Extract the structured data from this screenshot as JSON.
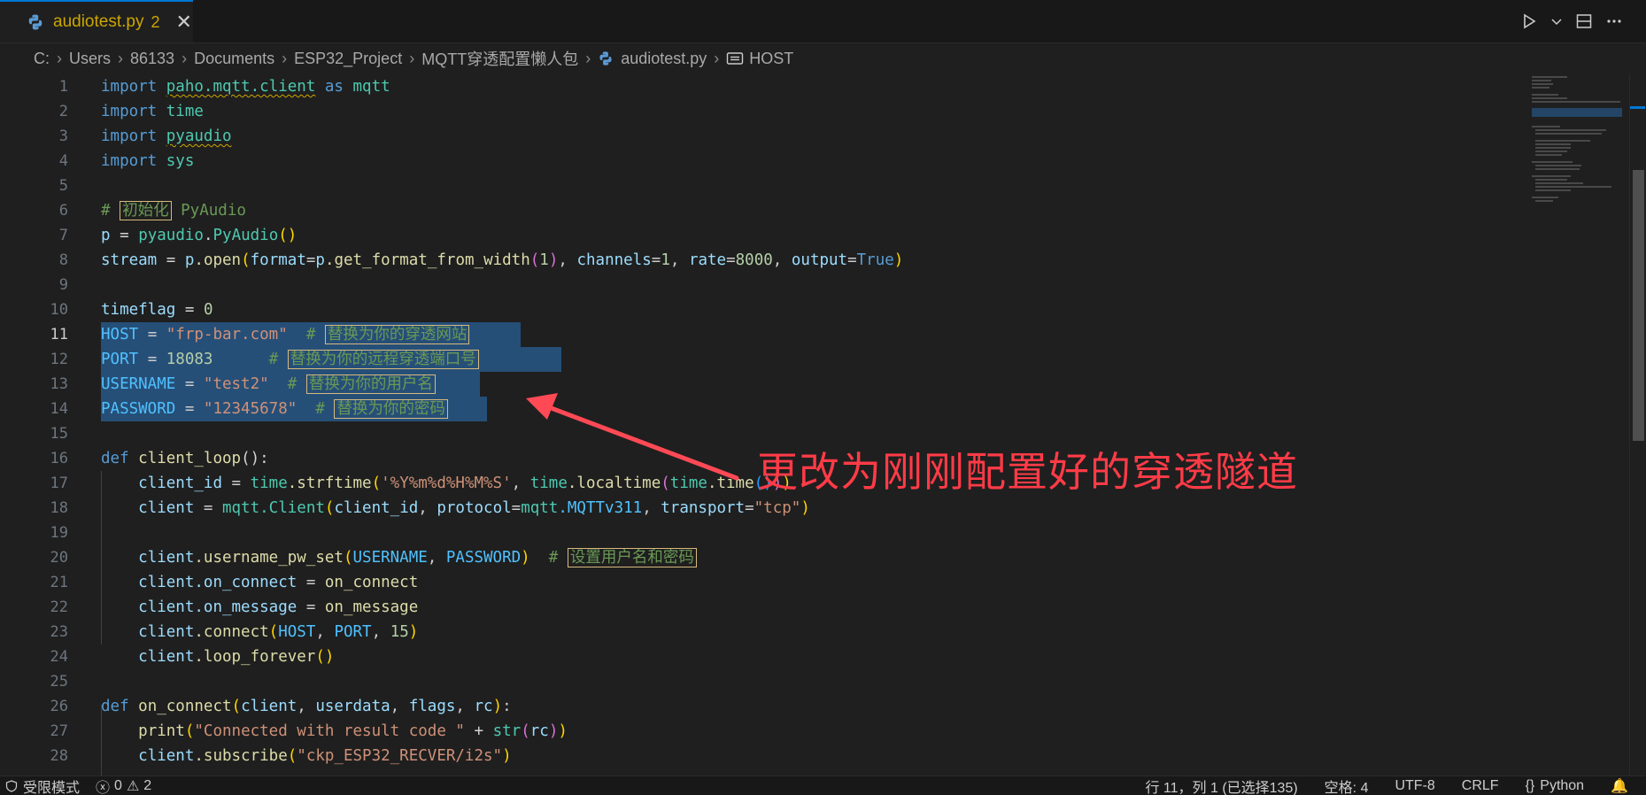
{
  "tab": {
    "filename": "audiotest.py",
    "problems_count": "2",
    "close_glyph": "✕"
  },
  "icons": {
    "file": "python-icon",
    "run": "run-icon",
    "run_menu": "chevron-down-icon",
    "split": "split-editor-icon",
    "more": "more-actions-icon",
    "symbol": "symbol-constant-icon"
  },
  "breadcrumb": {
    "items": [
      "C:",
      "Users",
      "86133",
      "Documents",
      "ESP32_Project",
      "MQTT穿透配置懒人包",
      "audiotest.py",
      "HOST"
    ]
  },
  "annotation": {
    "text": "更改为刚刚配置好的穿透隧道"
  },
  "status": {
    "mode": "受限模式",
    "errors": "0",
    "warnings": "2",
    "position": "行 11，列 1 (已选择135)",
    "indent": "空格: 4",
    "encoding": "UTF-8",
    "eol": "CRLF",
    "language": "Python"
  },
  "line_numbers": [
    "1",
    "2",
    "3",
    "4",
    "5",
    "6",
    "7",
    "8",
    "9",
    "10",
    "11",
    "12",
    "13",
    "14",
    "15",
    "16",
    "17",
    "18",
    "19",
    "20",
    "21",
    "22",
    "23",
    "24",
    "25",
    "26",
    "27",
    "28"
  ],
  "code": {
    "l1": {
      "kw": "import",
      "mod": "paho.mqtt.client",
      "as": "as",
      "alias": "mqtt"
    },
    "l2": {
      "kw": "import",
      "mod": "time"
    },
    "l3": {
      "kw": "import",
      "mod": "pyaudio"
    },
    "l4": {
      "kw": "import",
      "mod": "sys"
    },
    "l6": {
      "hash": "#",
      "zh": "初始化",
      "rest": "PyAudio"
    },
    "l7": {
      "a": "p",
      "eq": "=",
      "b": "pyaudio",
      "dot": ".",
      "c": "PyAudio",
      "par": "()"
    },
    "l8": {
      "a": "stream",
      "eq": "=",
      "b": "p",
      "c": ".open",
      "p1": "(",
      "k1": "format",
      "v1": "p",
      "f1": ".get_format_from_width",
      "p2": "(",
      "n1": "1",
      "p3": ")",
      "k2": "channels",
      "n2": "1",
      "k3": "rate",
      "n3": "8000",
      "k4": "output",
      "v4": "True",
      "p4": ")"
    },
    "l10": {
      "a": "timeflag",
      "eq": "=",
      "n": "0"
    },
    "l11": {
      "name": "HOST",
      "val": "\"frp-bar.com\"",
      "hash": "#",
      "zh": "替换为你的穿透网站"
    },
    "l12": {
      "name": "PORT",
      "val": "18083",
      "hash": "#",
      "zh": "替换为你的远程穿透端口号"
    },
    "l13": {
      "name": "USERNAME",
      "val": "\"test2\"",
      "hash": "#",
      "zh": "替换为你的用户名"
    },
    "l14": {
      "name": "PASSWORD",
      "val": "\"12345678\"",
      "hash": "#",
      "zh": "替换为你的密码"
    },
    "l16": {
      "def": "def",
      "fn": "client_loop",
      "rest": "():"
    },
    "l17": {
      "a": "client_id",
      "b": "time",
      "c": ".strftime",
      "s": "'%Y%m%d%H%M%S'",
      "d": "time",
      "e": ".localtime",
      "f": "time",
      "g": ".time"
    },
    "l18": {
      "a": "client",
      "b": "mqtt",
      "c": ".Client",
      "d": "client_id",
      "e": "protocol",
      "f": "mqtt",
      "g": ".MQTTv311",
      "h": "transport",
      "s": "\"tcp\""
    },
    "l20": {
      "a": "client",
      "b": ".username_pw_set",
      "c": "USERNAME",
      "d": "PASSWORD",
      "hash": "#",
      "zh": "设置用户名和密码"
    },
    "l21": {
      "a": "client",
      "b": ".on_connect",
      "c": "on_connect"
    },
    "l22": {
      "a": "client",
      "b": ".on_message",
      "c": "on_message"
    },
    "l23": {
      "a": "client",
      "b": ".connect",
      "c": "HOST",
      "d": "PORT",
      "n": "15"
    },
    "l24": {
      "a": "client",
      "b": ".loop_forever",
      "par": "()"
    },
    "l26": {
      "def": "def",
      "fn": "on_connect",
      "a": "client",
      "b": "userdata",
      "c": "flags",
      "d": "rc"
    },
    "l27": {
      "fn": "print",
      "s": "\"Connected with result code \"",
      "plus": "+",
      "g": "str",
      "a": "rc"
    },
    "l28": {
      "a": "client",
      "b": ".subscribe",
      "s": "\"ckp_ESP32_RECVER/i2s\""
    }
  }
}
